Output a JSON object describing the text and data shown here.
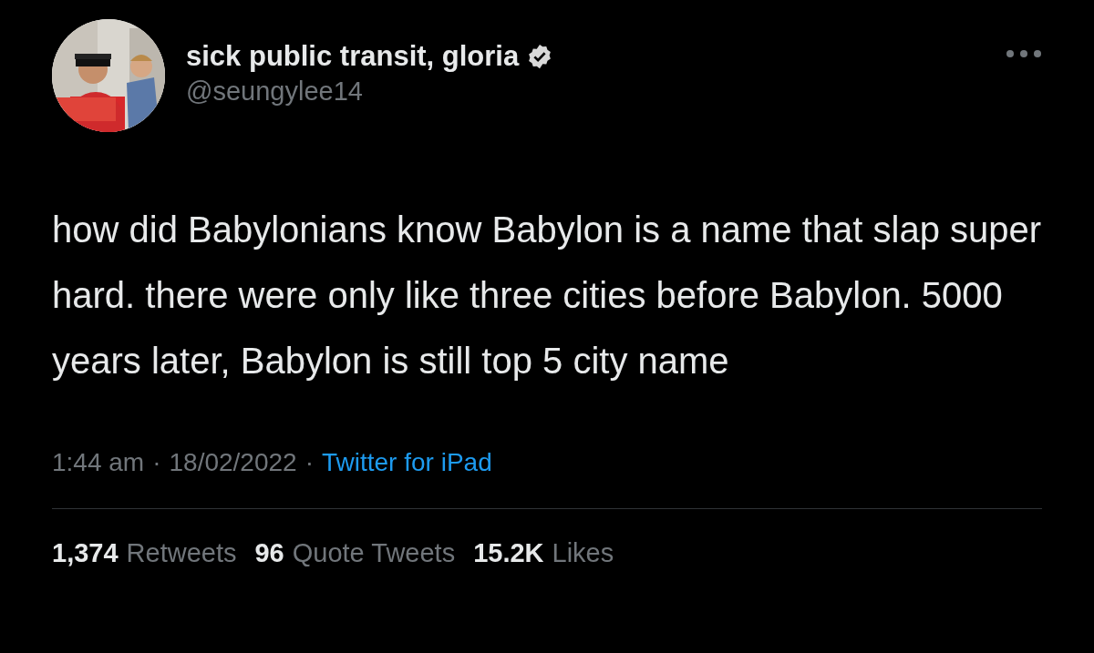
{
  "author": {
    "display_name": "sick public transit, gloria",
    "verified": true,
    "handle": "@seungylee14"
  },
  "tweet": {
    "text": "how did Babylonians know Babylon is a name that slap super hard. there were only like three cities before Babylon. 5000 years later, Babylon is still top 5 city name"
  },
  "meta": {
    "time": "1:44 am",
    "separator": "·",
    "date": "18/02/2022",
    "source": "Twitter for iPad"
  },
  "stats": [
    {
      "count": "1,374",
      "label": "Retweets"
    },
    {
      "count": "96",
      "label": "Quote Tweets"
    },
    {
      "count": "15.2K",
      "label": "Likes"
    }
  ]
}
